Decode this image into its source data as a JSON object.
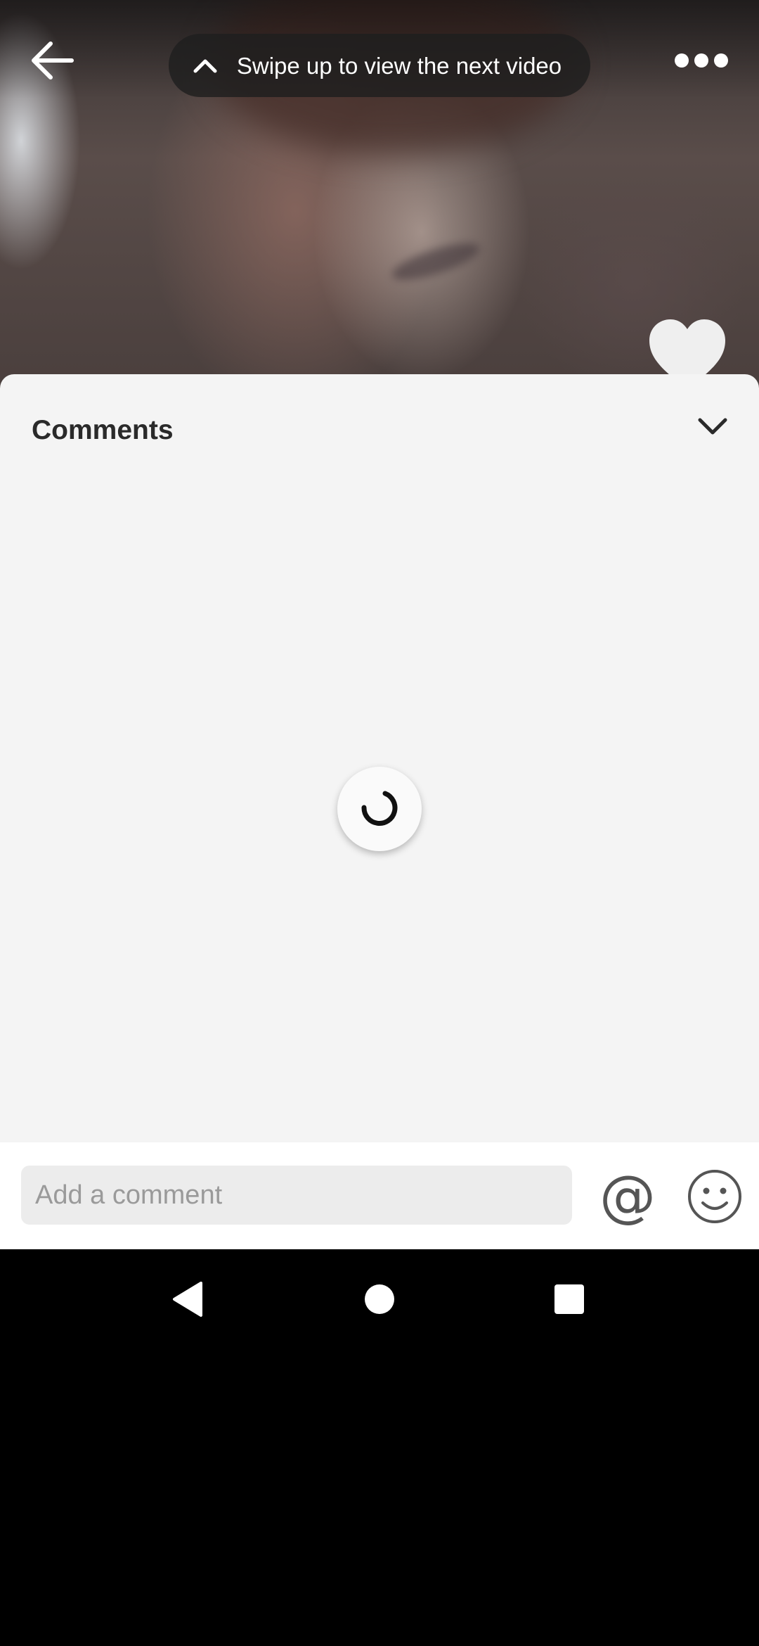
{
  "video": {
    "swipe_hint": "Swipe up to view the next video"
  },
  "comments": {
    "title": "Comments",
    "loading": true
  },
  "composer": {
    "placeholder": "Add a comment",
    "value": ""
  },
  "colors": {
    "sheet_background": "#f4f4f4",
    "composer_background": "#ffffff",
    "input_background": "#ececec",
    "hint_pill": "#1e1e1e",
    "nav_bar": "#000000"
  },
  "icons": {
    "back": "arrow-left-icon",
    "hint": "chevron-up-icon",
    "more": "three-dots-icon",
    "like": "heart-icon",
    "collapse": "chevron-down-icon",
    "loading": "spinner-icon",
    "mention": "at-sign-icon",
    "emoji": "smiley-icon",
    "nav_back": "triangle-back-icon",
    "nav_home": "circle-home-icon",
    "nav_recents": "square-recents-icon"
  }
}
